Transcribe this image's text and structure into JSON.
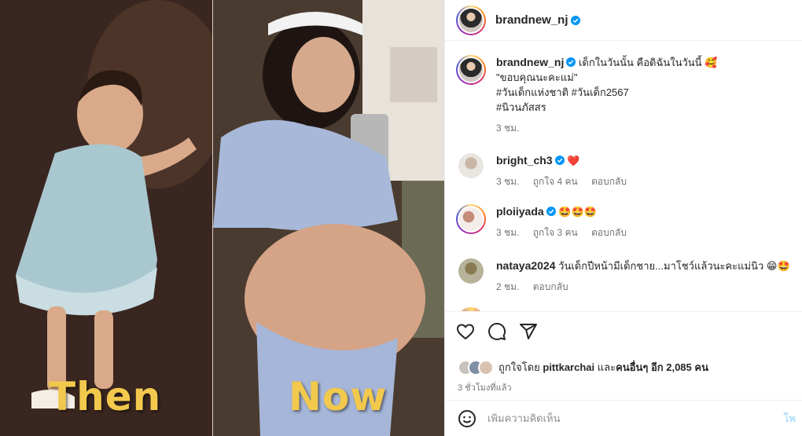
{
  "photo": {
    "left_word": "Then",
    "right_word": "Now",
    "accent_color": "#f2c94c"
  },
  "post": {
    "author": "brandnew_nj",
    "caption": {
      "line1": "เด็กในวันนั้น คือดิฉันในวันนี้ 🥰",
      "line2": "\"ขอบคุณนะคะแม่\"",
      "hashtags1": "#วันเด็กแห่งชาติ #วันเด็ก2567",
      "hashtags2": "#นิวนภัสสร",
      "time": "3 ชม."
    },
    "comments": [
      {
        "username": "bright_ch3",
        "verified": true,
        "text": "❤️",
        "time": "3 ชม.",
        "likes": "ถูกใจ 4 คน",
        "reply": "ตอบกลับ"
      },
      {
        "username": "ploiiyada",
        "verified": true,
        "text": "🤩🤩🤩",
        "time": "3 ชม.",
        "likes": "ถูกใจ 3 คน",
        "reply": "ตอบกลับ"
      },
      {
        "username": "nataya2024",
        "verified": false,
        "text": "วันเด็กปีหน้ามีเด็กชาย...มาโชว์แล้วนะคะแม่นิว 😁🤩",
        "time": "2 ชม.",
        "reply": "ตอบกลับ"
      }
    ],
    "likes": {
      "prefix": "ถูกใจโดย",
      "user": "pittkarchai",
      "middle": "และ",
      "others": "คนอื่นๆ อีก 2,085 คน"
    },
    "time_ago": "3 ชั่วโมงที่แล้ว",
    "comment_placeholder": "เพิ่มความคิดเห็น",
    "post_button": "โพ"
  },
  "icons": [
    "heart-icon",
    "comment-icon",
    "share-icon",
    "bookmark-icon",
    "emoji-icon",
    "verified-icon"
  ],
  "colors": {
    "verified": "#0095f6",
    "hashtag": "#00376b",
    "muted": "#737373"
  }
}
